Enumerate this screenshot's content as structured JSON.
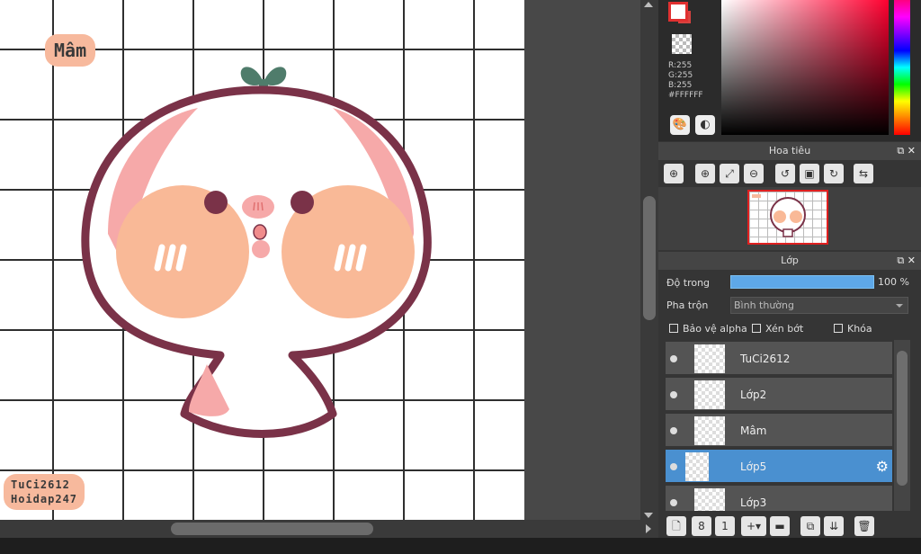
{
  "canvas": {
    "tag_mam": "Mâm",
    "signature_line1": "TuCi2612",
    "signature_line2": "Hoidap247"
  },
  "color_panel": {
    "r": "R:255",
    "g": "G:255",
    "b": "B:255",
    "hex": "#FFFFFF",
    "foreground_color": "#FFFFFF",
    "background_color": "#D8423F",
    "icons": [
      "palette-icon",
      "palette-alt-icon"
    ]
  },
  "navigator": {
    "title": "Hoa tiêu",
    "tools": [
      "zoom-fit-icon",
      "zoom-in-icon",
      "fit-screen-icon",
      "zoom-out-icon",
      "rotate-left-icon",
      "actual-size-icon",
      "rotate-right-icon",
      "flip-icon"
    ]
  },
  "layers_panel": {
    "title": "Lớp",
    "opacity_label": "Độ trong",
    "opacity_value": "100 %",
    "opacity": 1.0,
    "blend_label": "Pha trộn",
    "blend_value": "Bình thường",
    "protect_alpha": "Bảo vệ alpha",
    "clipping": "Xén bớt",
    "lock": "Khóa",
    "layers": [
      {
        "name": "TuCi2612",
        "selected": false
      },
      {
        "name": "Lớp2",
        "selected": false
      },
      {
        "name": "Mâm",
        "selected": false
      },
      {
        "name": "Lớp5",
        "selected": true
      },
      {
        "name": "Lớp3",
        "selected": false
      }
    ],
    "toolbar_icons": [
      "new-layer-icon",
      "new-8bit-layer-icon",
      "new-1bit-layer-icon",
      "add-layer-menu-icon",
      "folder-icon",
      "duplicate-icon",
      "merge-down-icon",
      "delete-icon"
    ]
  }
}
